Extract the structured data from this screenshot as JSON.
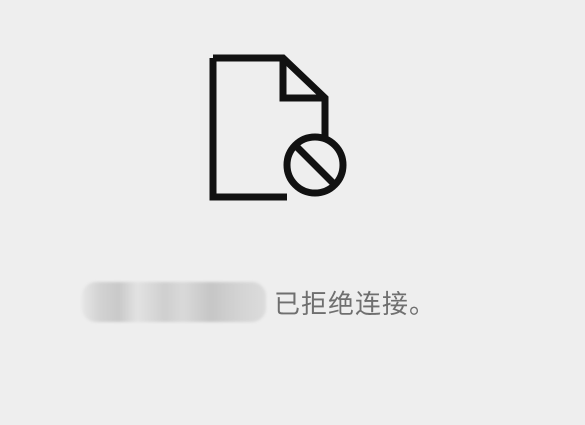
{
  "error": {
    "icon": "blocked-file-icon",
    "message": "已拒绝连接。",
    "host_redacted": true
  },
  "colors": {
    "background": "#eeeeee",
    "icon": "#111111",
    "text": "#6f6f6f"
  }
}
